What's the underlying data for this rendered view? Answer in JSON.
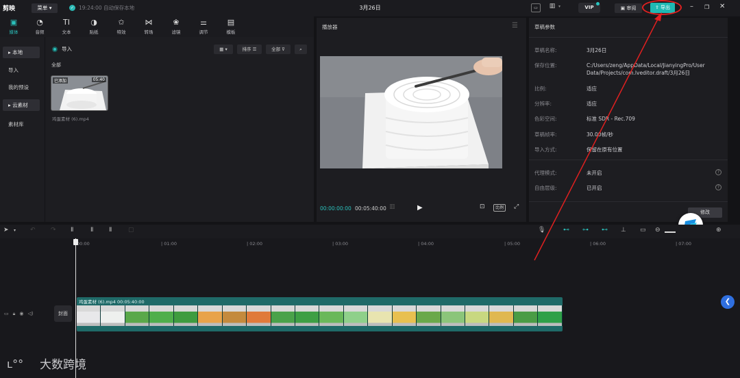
{
  "titlebar": {
    "app_logo": "剪映",
    "menu_label": "菜单 ▾",
    "autosave_text": "19:24:00 自动保存本地",
    "project_title": "3月26日",
    "vip_label": "VIP",
    "review_label": "审阅",
    "export_label": "导出",
    "colors": {
      "accent": "#1fb9b3",
      "highlight_ring": "#e02020"
    }
  },
  "tools": [
    {
      "label": "媒体",
      "icon": "media-icon",
      "glyph": "▣"
    },
    {
      "label": "音频",
      "icon": "audio-icon",
      "glyph": "◔"
    },
    {
      "label": "文本",
      "icon": "text-icon",
      "glyph": "TI"
    },
    {
      "label": "贴纸",
      "icon": "sticker-icon",
      "glyph": "◑"
    },
    {
      "label": "特效",
      "icon": "effects-icon",
      "glyph": "✩"
    },
    {
      "label": "转场",
      "icon": "transition-icon",
      "glyph": "⋈"
    },
    {
      "label": "滤镜",
      "icon": "filter-icon",
      "glyph": "❀"
    },
    {
      "label": "调节",
      "icon": "adjust-icon",
      "glyph": "⚌"
    },
    {
      "label": "模板",
      "icon": "template-icon",
      "glyph": "▤"
    }
  ],
  "sidebar": {
    "items": [
      {
        "label": "▸ 本地"
      },
      {
        "label": "导入"
      },
      {
        "label": "我的预设"
      },
      {
        "label": "▸ 云素材"
      },
      {
        "label": "素材库"
      }
    ]
  },
  "media": {
    "import_label": "导入",
    "sort_label": "排序",
    "filter_label": "全部",
    "all_label": "全部",
    "thumb": {
      "added_label": "已添加",
      "duration": "05:40",
      "filename": "鸡蛋素材 (6).mp4"
    }
  },
  "player": {
    "title": "播放器",
    "current_time": "00:00:00:00",
    "total_time": "00:05:40:00",
    "ratio_label": "比例"
  },
  "params": {
    "title": "草稿参数",
    "rows": [
      {
        "label": "草稿名称:",
        "value": "3月26日"
      },
      {
        "label": "保存位置:",
        "value": "C:/Users/zeng/AppData/Local/JianyingPro/User Data/Projects/com.lveditor.draft/3月26日"
      },
      {
        "label": "比例:",
        "value": "适应"
      },
      {
        "label": "分辨率:",
        "value": "适应"
      },
      {
        "label": "色彩空间:",
        "value": "标准 SDR - Rec.709"
      },
      {
        "label": "草稿帧率:",
        "value": "30.00帧/秒"
      },
      {
        "label": "导入方式:",
        "value": "保留在原有位置"
      },
      {
        "label": "代理模式:",
        "value": "未开启"
      },
      {
        "label": "自由层级:",
        "value": "已开启"
      }
    ],
    "modify_label": "修改"
  },
  "timeline": {
    "ruler": [
      "00:00",
      "| 01:00",
      "| 02:00",
      "| 03:00",
      "| 04:00",
      "| 05:00",
      "| 06:00",
      "| 07:00"
    ],
    "cover_label": "封面",
    "clip_label": "鸡蛋素材 (6).mp4  00:05:40:00",
    "frames": [
      "#e8e8ea",
      "#eef0ee",
      "#5aa84a",
      "#4fae4b",
      "#3f9c3f",
      "#e8a34a",
      "#c48a3d",
      "#e07a3a",
      "#4aa24a",
      "#3e9f44",
      "#6ab85a",
      "#8fd08a",
      "#e8e4b0",
      "#e8c050",
      "#6aa84a",
      "#8bc57a",
      "#c8d880",
      "#e0b850",
      "#4a9c45",
      "#2fa048"
    ]
  },
  "watermark": {
    "text": "大数跨境"
  }
}
